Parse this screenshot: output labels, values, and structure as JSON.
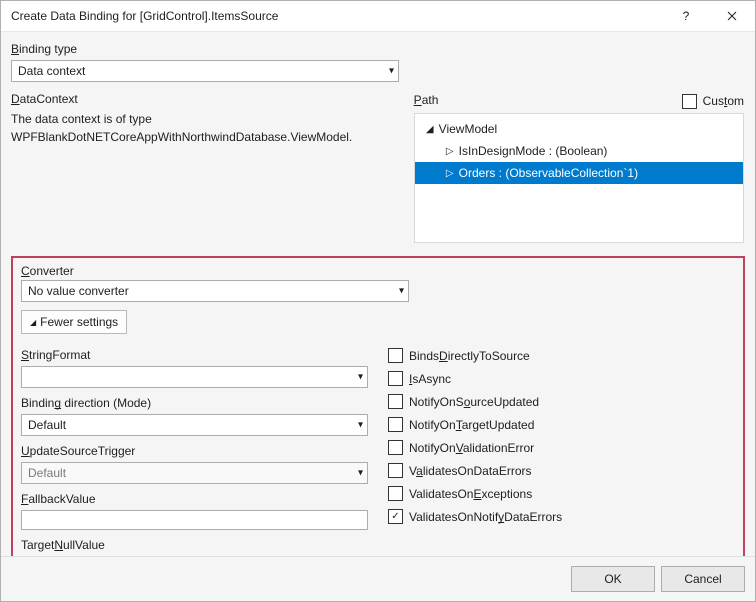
{
  "titlebar": {
    "title": "Create Data Binding for [GridControl].ItemsSource"
  },
  "top": {
    "binding_type_label": "Binding type",
    "binding_type_value": "Data context",
    "data_context_label": "DataContext",
    "data_context_desc_line1": "The data context is of type",
    "data_context_desc_line2": "WPFBlankDotNETCoreAppWithNorthwindDatabase.ViewModel.",
    "path_label": "Path",
    "custom_label": "Custom"
  },
  "tree": {
    "root": "ViewModel",
    "item0": "IsInDesignMode : (Boolean)",
    "item1": "Orders : (ObservableCollection`1)"
  },
  "conv": {
    "label": "Converter",
    "value": "No value converter",
    "fewer": "Fewer settings"
  },
  "left": {
    "string_format_label": "StringFormat",
    "binding_direction_label": "Binding direction (Mode)",
    "binding_direction_value": "Default",
    "update_source_trigger_label": "UpdateSourceTrigger",
    "update_source_trigger_value": "Default",
    "fallback_value_label": "FallbackValue",
    "target_null_value_label": "TargetNullValue"
  },
  "right": {
    "c0": "BindsDirectlyToSource",
    "c1": "IsAsync",
    "c2": "NotifyOnSourceUpdated",
    "c3": "NotifyOnTargetUpdated",
    "c4": "NotifyOnValidationError",
    "c5": "ValidatesOnDataErrors",
    "c6": "ValidatesOnExceptions",
    "c7": "ValidatesOnNotifyDataErrors"
  },
  "buttons": {
    "ok": "OK",
    "cancel": "Cancel"
  }
}
